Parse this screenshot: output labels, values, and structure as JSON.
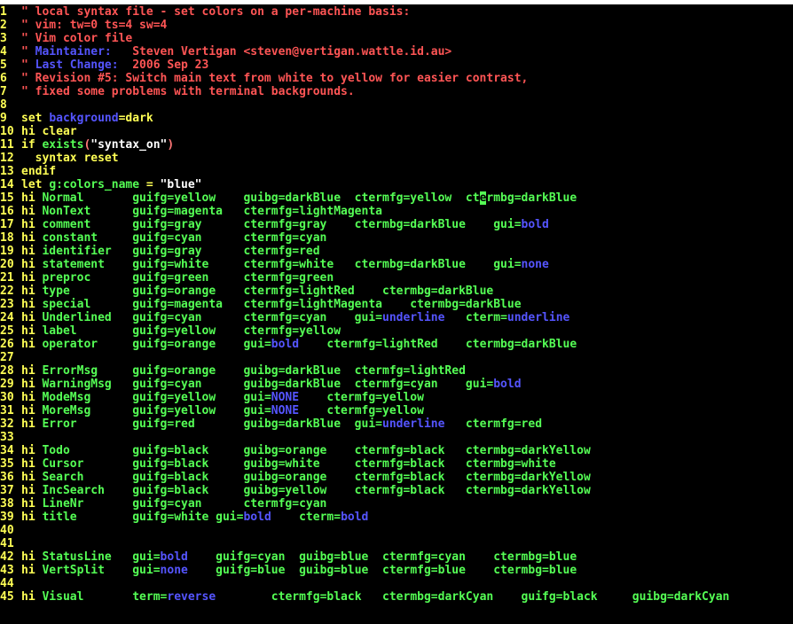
{
  "colors": {
    "background": "#000000",
    "line_number": "#ffff55",
    "comment": "#ff5555",
    "keyword": "#ffff55",
    "identifier": "#5555ff",
    "argument": "#55ff55",
    "cursor": "#55ff55"
  },
  "lines": [
    {
      "n": "1",
      "segs": [
        {
          "t": "\" local syntax file - set colors on a per-machine basis:",
          "c": "c"
        }
      ]
    },
    {
      "n": "2",
      "segs": [
        {
          "t": "\" vim: tw=0 ts=4 sw=4",
          "c": "c"
        }
      ]
    },
    {
      "n": "3",
      "segs": [
        {
          "t": "\" Vim color file",
          "c": "c"
        }
      ]
    },
    {
      "n": "4",
      "segs": [
        {
          "t": "\" ",
          "c": "c"
        },
        {
          "t": "Maintainer:",
          "c": "i"
        },
        {
          "t": "   Steven Vertigan <steven@vertigan.wattle.id.au>",
          "c": "c"
        }
      ]
    },
    {
      "n": "5",
      "segs": [
        {
          "t": "\" ",
          "c": "c"
        },
        {
          "t": "Last Change:",
          "c": "i"
        },
        {
          "t": "  2006 Sep 23",
          "c": "c"
        }
      ]
    },
    {
      "n": "6",
      "segs": [
        {
          "t": "\" Revision #5: Switch main text from white to yellow for easier contrast,",
          "c": "c"
        }
      ]
    },
    {
      "n": "7",
      "segs": [
        {
          "t": "\" fixed some problems with terminal backgrounds.",
          "c": "c"
        }
      ]
    },
    {
      "n": "8",
      "segs": []
    },
    {
      "n": "9",
      "segs": [
        {
          "t": "set ",
          "c": "k"
        },
        {
          "t": "background",
          "c": "i"
        },
        {
          "t": "=dark",
          "c": "k"
        }
      ]
    },
    {
      "n": "10",
      "segs": [
        {
          "t": "hi clear",
          "c": "k"
        }
      ]
    },
    {
      "n": "11",
      "segs": [
        {
          "t": "if ",
          "c": "k"
        },
        {
          "t": "exists",
          "c": "g"
        },
        {
          "t": "(",
          "c": "s"
        },
        {
          "t": "\"syntax_on\"",
          "c": "w"
        },
        {
          "t": ")",
          "c": "s"
        }
      ]
    },
    {
      "n": "12",
      "segs": [
        {
          "t": "  syntax reset",
          "c": "k"
        }
      ]
    },
    {
      "n": "13",
      "segs": [
        {
          "t": "endif",
          "c": "k"
        }
      ]
    },
    {
      "n": "14",
      "segs": [
        {
          "t": "let ",
          "c": "k"
        },
        {
          "t": "g:colors_name",
          "c": "g"
        },
        {
          "t": " = ",
          "c": "k"
        },
        {
          "t": "\"blue\"",
          "c": "w"
        }
      ]
    },
    {
      "n": "15",
      "segs": [
        {
          "t": "hi ",
          "c": "k"
        },
        {
          "t": "Normal       guifg=yellow    guibg=darkBlue  ctermfg=yellow  ct",
          "c": "g"
        },
        {
          "t": "e",
          "c": "cur"
        },
        {
          "t": "rmbg=darkBlue",
          "c": "g"
        }
      ]
    },
    {
      "n": "16",
      "segs": [
        {
          "t": "hi ",
          "c": "k"
        },
        {
          "t": "NonText      guifg=magenta   ctermfg=lightMagenta",
          "c": "g"
        }
      ]
    },
    {
      "n": "17",
      "segs": [
        {
          "t": "hi ",
          "c": "k"
        },
        {
          "t": "comment      guifg=gray      ctermfg=gray    ctermbg=darkBlue    gui=",
          "c": "g"
        },
        {
          "t": "bold",
          "c": "i"
        }
      ]
    },
    {
      "n": "18",
      "segs": [
        {
          "t": "hi ",
          "c": "k"
        },
        {
          "t": "constant     guifg=cyan      ctermfg=cyan",
          "c": "g"
        }
      ]
    },
    {
      "n": "19",
      "segs": [
        {
          "t": "hi ",
          "c": "k"
        },
        {
          "t": "identifier   guifg=gray      ctermfg=red",
          "c": "g"
        }
      ]
    },
    {
      "n": "20",
      "segs": [
        {
          "t": "hi ",
          "c": "k"
        },
        {
          "t": "statement    guifg=white     ctermfg=white   ctermbg=darkBlue    gui=",
          "c": "g"
        },
        {
          "t": "none",
          "c": "i"
        }
      ]
    },
    {
      "n": "21",
      "segs": [
        {
          "t": "hi ",
          "c": "k"
        },
        {
          "t": "preproc      guifg=green     ctermfg=green",
          "c": "g"
        }
      ]
    },
    {
      "n": "22",
      "segs": [
        {
          "t": "hi ",
          "c": "k"
        },
        {
          "t": "type         guifg=orange    ctermfg=lightRed    ctermbg=darkBlue",
          "c": "g"
        }
      ]
    },
    {
      "n": "23",
      "segs": [
        {
          "t": "hi ",
          "c": "k"
        },
        {
          "t": "special      guifg=magenta   ctermfg=lightMagenta    ctermbg=darkBlue",
          "c": "g"
        }
      ]
    },
    {
      "n": "24",
      "segs": [
        {
          "t": "hi ",
          "c": "k"
        },
        {
          "t": "Underlined   guifg=cyan      ctermfg=cyan    gui=",
          "c": "g"
        },
        {
          "t": "underline",
          "c": "i"
        },
        {
          "t": "   cterm=",
          "c": "g"
        },
        {
          "t": "underline",
          "c": "i"
        }
      ]
    },
    {
      "n": "25",
      "segs": [
        {
          "t": "hi ",
          "c": "k"
        },
        {
          "t": "label        guifg=yellow    ctermfg=yellow",
          "c": "g"
        }
      ]
    },
    {
      "n": "26",
      "segs": [
        {
          "t": "hi ",
          "c": "k"
        },
        {
          "t": "operator     guifg=orange    gui=",
          "c": "g"
        },
        {
          "t": "bold",
          "c": "i"
        },
        {
          "t": "    ctermfg=lightRed    ctermbg=darkBlue",
          "c": "g"
        }
      ]
    },
    {
      "n": "27",
      "segs": []
    },
    {
      "n": "28",
      "segs": [
        {
          "t": "hi ",
          "c": "k"
        },
        {
          "t": "ErrorMsg     guifg=orange    guibg=darkBlue  ctermfg=lightRed",
          "c": "g"
        }
      ]
    },
    {
      "n": "29",
      "segs": [
        {
          "t": "hi ",
          "c": "k"
        },
        {
          "t": "WarningMsg   guifg=cyan      guibg=darkBlue  ctermfg=cyan    gui=",
          "c": "g"
        },
        {
          "t": "bold",
          "c": "i"
        }
      ]
    },
    {
      "n": "30",
      "segs": [
        {
          "t": "hi ",
          "c": "k"
        },
        {
          "t": "ModeMsg      guifg=yellow    gui=",
          "c": "g"
        },
        {
          "t": "NONE",
          "c": "i"
        },
        {
          "t": "    ctermfg=yellow",
          "c": "g"
        }
      ]
    },
    {
      "n": "31",
      "segs": [
        {
          "t": "hi ",
          "c": "k"
        },
        {
          "t": "MoreMsg      guifg=yellow    gui=",
          "c": "g"
        },
        {
          "t": "NONE",
          "c": "i"
        },
        {
          "t": "    ctermfg=yellow",
          "c": "g"
        }
      ]
    },
    {
      "n": "32",
      "segs": [
        {
          "t": "hi ",
          "c": "k"
        },
        {
          "t": "Error        guifg=red       guibg=darkBlue  gui=",
          "c": "g"
        },
        {
          "t": "underline",
          "c": "i"
        },
        {
          "t": "   ctermfg=red",
          "c": "g"
        }
      ]
    },
    {
      "n": "33",
      "segs": []
    },
    {
      "n": "34",
      "segs": [
        {
          "t": "hi ",
          "c": "k"
        },
        {
          "t": "Todo         guifg=black     guibg=orange    ctermfg=black   ctermbg=darkYellow",
          "c": "g"
        }
      ]
    },
    {
      "n": "35",
      "segs": [
        {
          "t": "hi ",
          "c": "k"
        },
        {
          "t": "Cursor       guifg=black     guibg=white     ctermfg=black   ctermbg=white",
          "c": "g"
        }
      ]
    },
    {
      "n": "36",
      "segs": [
        {
          "t": "hi ",
          "c": "k"
        },
        {
          "t": "Search       guifg=black     guibg=orange    ctermfg=black   ctermbg=darkYellow",
          "c": "g"
        }
      ]
    },
    {
      "n": "37",
      "segs": [
        {
          "t": "hi ",
          "c": "k"
        },
        {
          "t": "IncSearch    guifg=black     guibg=yellow    ctermfg=black   ctermbg=darkYellow",
          "c": "g"
        }
      ]
    },
    {
      "n": "38",
      "segs": [
        {
          "t": "hi ",
          "c": "k"
        },
        {
          "t": "LineNr       guifg=cyan      ctermfg=cyan",
          "c": "g"
        }
      ]
    },
    {
      "n": "39",
      "segs": [
        {
          "t": "hi ",
          "c": "k"
        },
        {
          "t": "title        guifg=white gui=",
          "c": "g"
        },
        {
          "t": "bold",
          "c": "i"
        },
        {
          "t": "    cterm=",
          "c": "g"
        },
        {
          "t": "bold",
          "c": "i"
        }
      ]
    },
    {
      "n": "40",
      "segs": []
    },
    {
      "n": "41",
      "segs": []
    },
    {
      "n": "42",
      "segs": [
        {
          "t": "hi ",
          "c": "k"
        },
        {
          "t": "StatusLine   gui=",
          "c": "g"
        },
        {
          "t": "bold",
          "c": "i"
        },
        {
          "t": "    guifg=cyan  guibg=blue  ctermfg=cyan    ctermbg=blue",
          "c": "g"
        }
      ]
    },
    {
      "n": "43",
      "segs": [
        {
          "t": "hi ",
          "c": "k"
        },
        {
          "t": "VertSplit    gui=",
          "c": "g"
        },
        {
          "t": "none",
          "c": "i"
        },
        {
          "t": "    guifg=blue  guibg=blue  ctermfg=blue    ctermbg=blue",
          "c": "g"
        }
      ]
    },
    {
      "n": "44",
      "segs": []
    },
    {
      "n": "45",
      "segs": [
        {
          "t": "hi ",
          "c": "k"
        },
        {
          "t": "Visual       term=",
          "c": "g"
        },
        {
          "t": "reverse",
          "c": "i"
        },
        {
          "t": "        ctermfg=black   ctermbg=darkCyan    guifg=black     guibg=darkCyan",
          "c": "g"
        }
      ]
    }
  ]
}
